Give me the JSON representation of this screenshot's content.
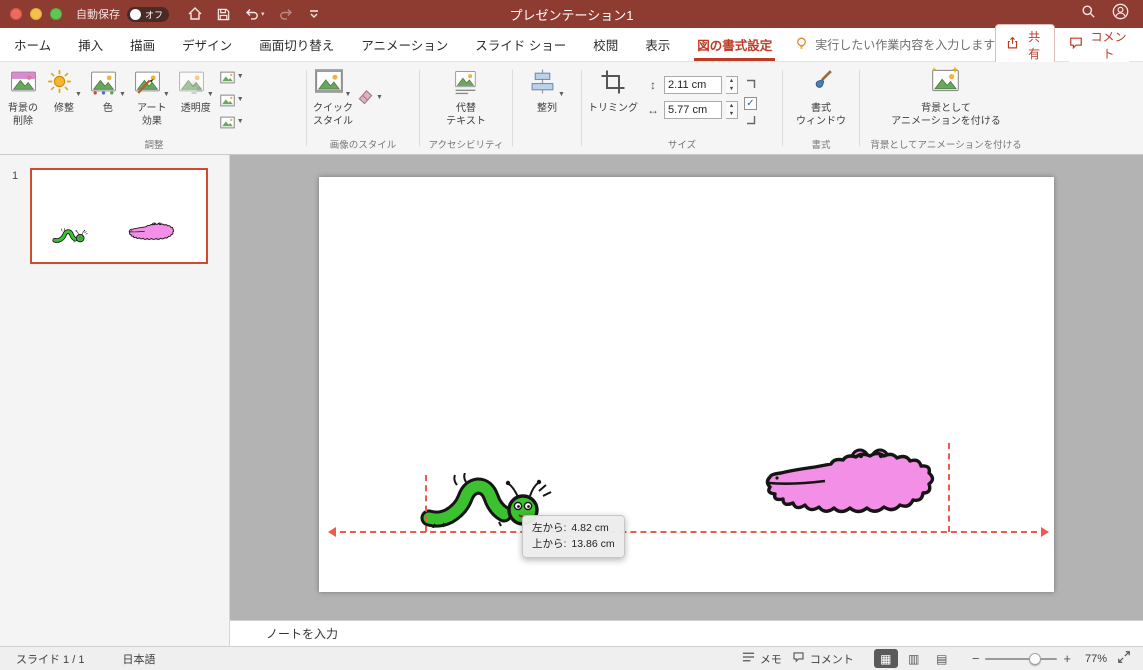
{
  "titlebar": {
    "autosave_label": "自動保存",
    "autosave_state": "オフ",
    "title": "プレゼンテーション1"
  },
  "tabs": {
    "items": [
      {
        "label": "ホーム"
      },
      {
        "label": "挿入"
      },
      {
        "label": "描画"
      },
      {
        "label": "デザイン"
      },
      {
        "label": "画面切り替え"
      },
      {
        "label": "アニメーション"
      },
      {
        "label": "スライド ショー"
      },
      {
        "label": "校閲"
      },
      {
        "label": "表示"
      },
      {
        "label": "図の書式設定"
      }
    ],
    "tellme": "実行したい作業内容を入力します",
    "share_label": "共有",
    "comments_label": "コメント"
  },
  "ribbon": {
    "adjust": {
      "group_label": "調整",
      "remove_bg_line1": "背景の",
      "remove_bg_line2": "削除",
      "corrections": "修整",
      "color": "色",
      "artistic_line1": "アート",
      "artistic_line2": "効果",
      "transparency": "透明度"
    },
    "picture_styles": {
      "group_label": "画像のスタイル",
      "quick_line1": "クイック",
      "quick_line2": "スタイル"
    },
    "accessibility": {
      "group_label": "アクセシビリティ",
      "alt_line1": "代替",
      "alt_line2": "テキスト"
    },
    "arrange": {
      "align": "整列"
    },
    "size": {
      "group_label": "サイズ",
      "crop": "トリミング",
      "height_value": "2.11 cm",
      "width_value": "5.77 cm"
    },
    "format": {
      "group_label": "書式",
      "pane_line1": "書式",
      "pane_line2": "ウィンドウ"
    },
    "bg_animation": {
      "group_label": "背景としてアニメーションを付ける",
      "button_line1": "背景として",
      "button_line2": "アニメーションを付ける"
    }
  },
  "slides_panel": {
    "slide_number": "1"
  },
  "canvas": {
    "tooltip": {
      "left_label": "左から:",
      "left_value": "4.82 cm",
      "top_label": "上から:",
      "top_value": "13.86 cm"
    }
  },
  "notes": {
    "placeholder": "ノートを入力"
  },
  "statusbar": {
    "slide_info": "スライド 1 / 1",
    "language": "日本語",
    "memo_label": "メモ",
    "comments_label": "コメント",
    "zoom_value": "77%"
  },
  "colors": {
    "titlebar_bg": "#8E3B32",
    "accent_red": "#BE3B26",
    "guide_red": "#ED5A4E",
    "thumbnail_border": "#CF4A2E",
    "caterpillar_green": "#3CC12F",
    "crocodile_pink": "#F48FE8"
  }
}
